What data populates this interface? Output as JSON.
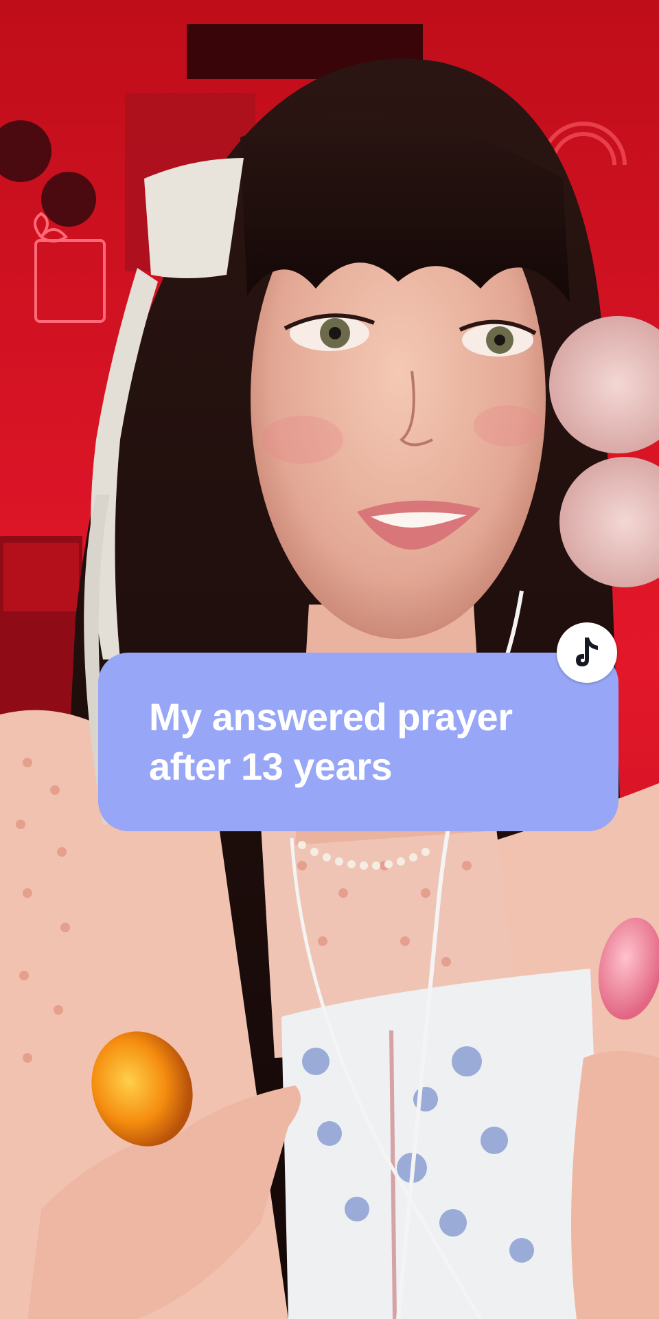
{
  "video": {
    "caption_lines": [
      "My answered prayer",
      "after 13 years"
    ]
  },
  "icons": {
    "logo": "tiktok-logo-icon"
  },
  "colors": {
    "caption_bg": "#97a6f6",
    "caption_text": "#ffffff",
    "room_red": "#d3121f",
    "badge_bg": "#ffffff",
    "logo": "#161823"
  }
}
